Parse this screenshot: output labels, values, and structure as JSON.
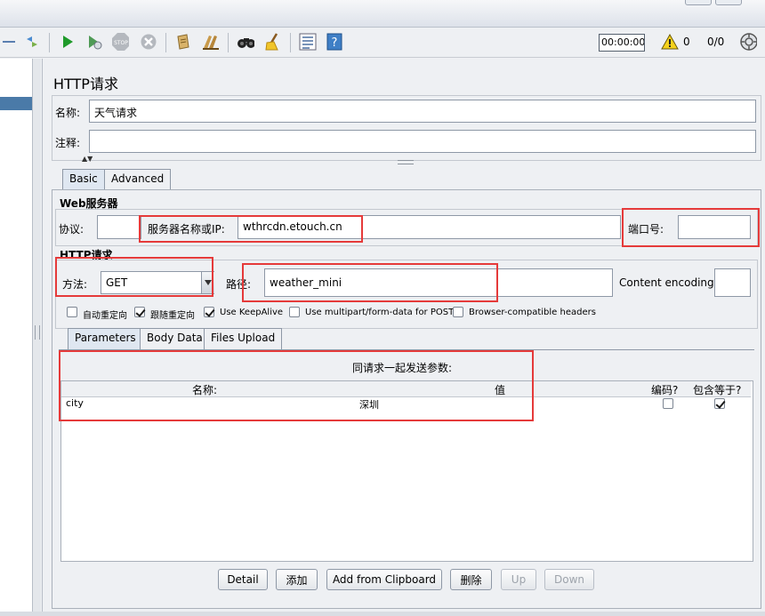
{
  "toolbar": {
    "timer": "00:00:00",
    "warning_count": "0",
    "thread_ratio": "0/0",
    "icons": [
      "run-icon",
      "run-no-pause-icon",
      "stop-icon",
      "shutdown-icon",
      "clear-icon",
      "clear-all-icon",
      "search-icon",
      "broom-icon",
      "list-icon",
      "help-icon",
      "warning-icon",
      "remote-icon"
    ]
  },
  "panel": {
    "title": "HTTP请求",
    "name_label": "名称:",
    "name_value": "天气请求",
    "comment_label": "注释:",
    "comment_value": ""
  },
  "tabs": [
    "Basic",
    "Advanced"
  ],
  "web_server": {
    "section_title": "Web服务器",
    "protocol_label": "协议:",
    "protocol_value": "",
    "server_label": "服务器名称或IP:",
    "server_value": "wthrcdn.etouch.cn",
    "port_label": "端口号:",
    "port_value": ""
  },
  "http_request": {
    "section_title": "HTTP请求",
    "method_label": "方法:",
    "method_value": "GET",
    "path_label": "路径:",
    "path_value": "weather_mini",
    "encoding_label": "Content encoding:",
    "encoding_value": ""
  },
  "options": [
    {
      "label": "自动重定向",
      "checked": false
    },
    {
      "label": "跟随重定向",
      "checked": true
    },
    {
      "label": "Use KeepAlive",
      "checked": true
    },
    {
      "label": "Use multipart/form-data for POST",
      "checked": false
    },
    {
      "label": "Browser-compatible headers",
      "checked": false
    }
  ],
  "param_tabs": [
    "Parameters",
    "Body Data",
    "Files Upload"
  ],
  "params_table": {
    "caption": "同请求一起发送参数:",
    "headers": [
      "名称:",
      "值",
      "编码?",
      "包含等于?"
    ],
    "rows": [
      {
        "name": "city",
        "value": "深圳",
        "encode": false,
        "include_equals": true
      }
    ]
  },
  "buttons": {
    "detail": "Detail",
    "add": "添加",
    "add_clipboard": "Add from Clipboard",
    "delete": "删除",
    "up": "Up",
    "down": "Down"
  },
  "colors": {
    "highlight": "#e53a3a",
    "selection": "#4a7aa8",
    "run": "#1f9a2a"
  }
}
